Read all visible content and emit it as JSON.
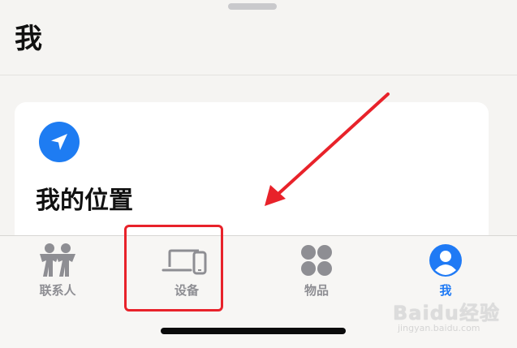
{
  "header": {
    "title": "我"
  },
  "card": {
    "title": "我的位置",
    "icon": "location-arrow-icon"
  },
  "tabs": [
    {
      "label": "联系人",
      "icon": "people-icon",
      "active": false
    },
    {
      "label": "设备",
      "icon": "devices-icon",
      "active": false
    },
    {
      "label": "物品",
      "icon": "items-icon",
      "active": false
    },
    {
      "label": "我",
      "icon": "me-icon",
      "active": true
    }
  ],
  "annotations": {
    "highlight_target": "设备",
    "color": "#e8222a"
  },
  "colors": {
    "accent": "#1f7af5",
    "inactive": "#8e8e93",
    "location": "#1e7cf2"
  },
  "watermark": {
    "brand": "Baidu经验",
    "url": "jingyan.baidu.com"
  }
}
